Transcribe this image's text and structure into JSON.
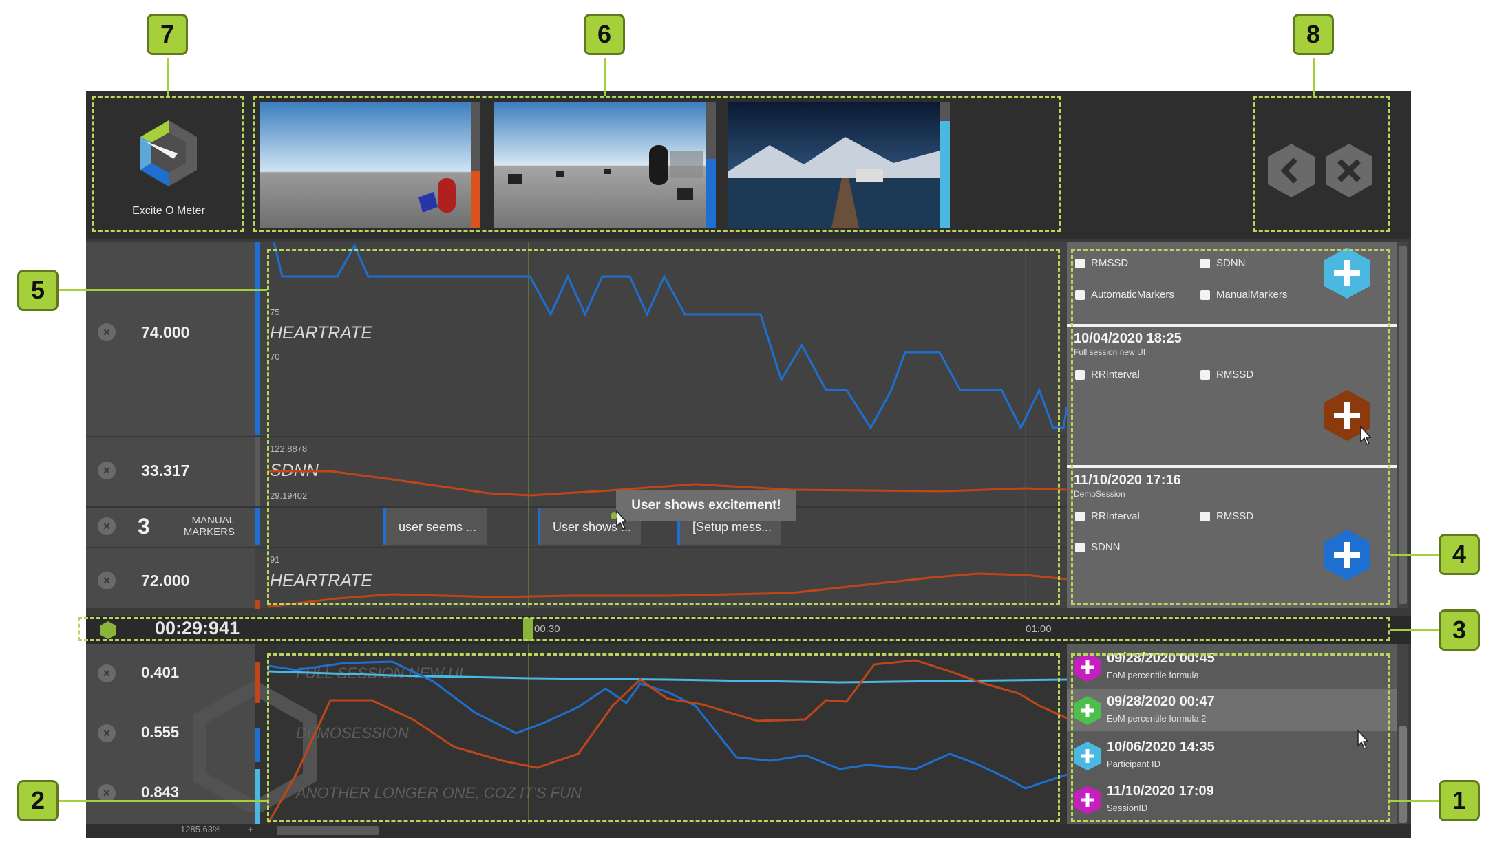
{
  "app": {
    "name": "Excite O Meter"
  },
  "header": {
    "thumbnails": [
      {
        "name": "session-thumb-1",
        "fill_fraction": 0.45,
        "fill_color": "#d9531e"
      },
      {
        "name": "session-thumb-2",
        "fill_fraction": 0.55,
        "fill_color": "#1e6fd0"
      },
      {
        "name": "session-thumb-3",
        "fill_fraction": 0.85,
        "fill_color": "#4ab8e0"
      }
    ],
    "back_icon": "chevron-left-icon",
    "close_icon": "close-icon"
  },
  "rows": [
    {
      "value": "74.000",
      "label": "HEARTRATE",
      "tick_top": "75",
      "tick_bottom": "70",
      "color": "#1e6fd0"
    },
    {
      "value": "33.317",
      "label": "SDNN",
      "tick_top": "122.8878",
      "tick_bottom": "29.19402",
      "color": "#c0461a"
    },
    {
      "value": "3",
      "label_line1": "MANUAL",
      "label_line2": "MARKERS"
    },
    {
      "value": "72.000",
      "label": "HEARTRATE",
      "tick_top": "91",
      "color": "#c0461a"
    }
  ],
  "markers": [
    "user seems ...",
    "User shows ...",
    "[Setup mess..."
  ],
  "tooltip": "User shows excitement!",
  "timeline": {
    "time": "00:29:941",
    "ticks": [
      "00:30",
      "01:00"
    ]
  },
  "right_panel": {
    "top_options": [
      "RMSSD",
      "SDNN",
      "AutomaticMarkers",
      "ManualMarkers"
    ],
    "sessions": [
      {
        "date": "10/04/2020 18:25",
        "name": "Full session new UI",
        "options": [
          "RRInterval",
          "RMSSD"
        ],
        "color": "#8a3a0c"
      },
      {
        "date": "11/10/2020 17:16",
        "name": "DemoSession",
        "options": [
          "RRInterval",
          "RMSSD",
          "SDNN"
        ],
        "color": "#1e6fd0"
      }
    ],
    "top_add_color": "#4ab8e0"
  },
  "bottom": {
    "rows": [
      {
        "value": "0.401",
        "label": "FULL SESSION NEW UI",
        "color": "#c0461a"
      },
      {
        "value": "0.555",
        "label": "DEMOSESSION",
        "color": "#1e6fd0"
      },
      {
        "value": "0.843",
        "label": "ANOTHER LONGER ONE, COZ IT'S FUN",
        "color": "#4ab8e0"
      }
    ],
    "recent": [
      {
        "date": "09/28/2020 00:45",
        "name": "EoM percentile formula",
        "color": "#c71fbf"
      },
      {
        "date": "09/28/2020 00:47",
        "name": "EoM percentile formula 2",
        "color": "#4cbf4c"
      },
      {
        "date": "10/06/2020 14:35",
        "name": "Participant ID",
        "color": "#4ab8e0"
      },
      {
        "date": "11/10/2020 17:09",
        "name": "SessionID",
        "color": "#c71fbf"
      }
    ]
  },
  "footer": {
    "zoom": "1285.63%",
    "minus": "-",
    "plus": "+"
  },
  "annotations": [
    "1",
    "2",
    "3",
    "4",
    "5",
    "6",
    "7",
    "8"
  ]
}
